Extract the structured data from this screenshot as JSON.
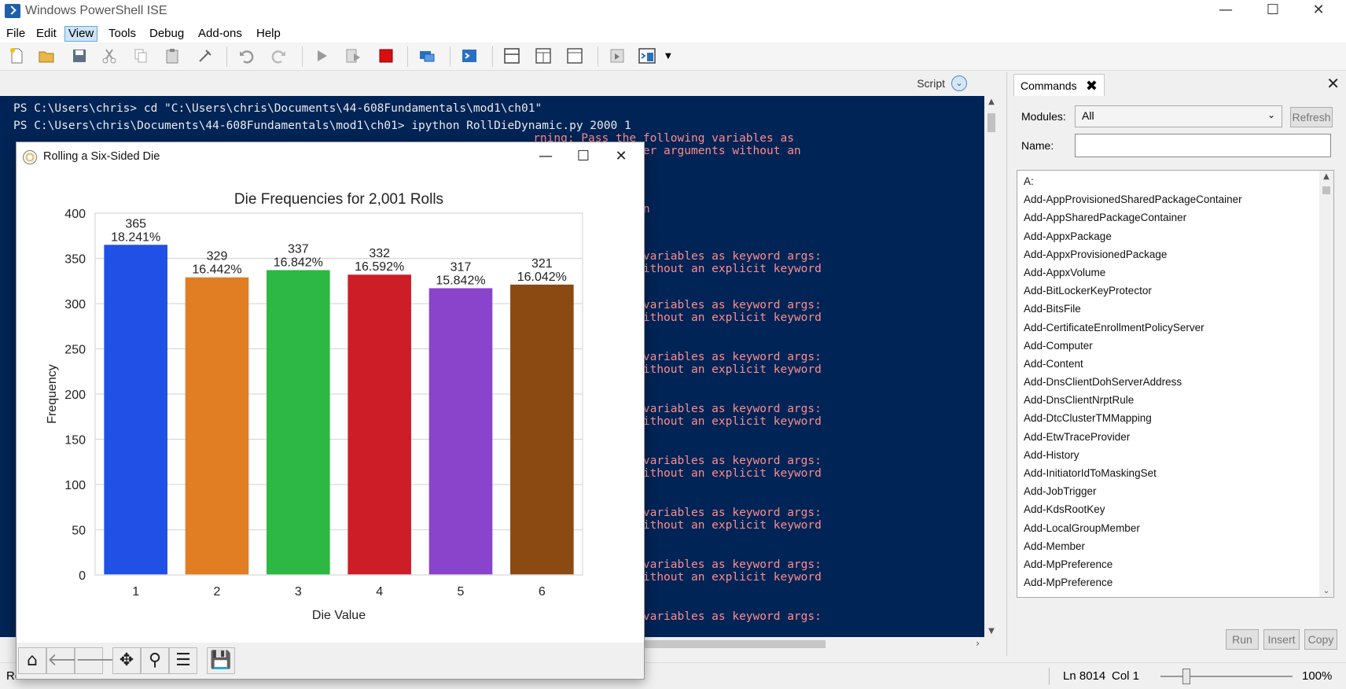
{
  "app": {
    "title": "Windows PowerShell ISE",
    "menu": [
      "File",
      "Edit",
      "View",
      "Tools",
      "Debug",
      "Add-ons",
      "Help"
    ],
    "active_menu": "View"
  },
  "script_bar": {
    "label": "Script"
  },
  "console": {
    "lines": [
      {
        "text": "PS C:\\Users\\chris> cd \"C:\\Users\\chris\\Documents\\44-608Fundamentals\\mod1\\ch01\"",
        "kind": "white"
      },
      {
        "text": "PS C:\\Users\\chris\\Documents\\44-608Fundamentals\\mod1\\ch01> ipython RollDieDynamic.py 2000 1",
        "kind": "white"
      },
      {
        "text": "rning: Pass the following variables as",
        "kind": "err",
        "col": 76
      },
      {
        "text": " and passing other arguments without an",
        "kind": "err",
        "col": 76
      },
      {
        "text": ", RemoteException",
        "kind": "err",
        "col": 76
      },
      {
        "text": "s the following variables as keyword args:",
        "kind": "err",
        "col": 76
      },
      {
        "text": "ther arguments without an explicit keyword",
        "kind": "err",
        "col": 76
      },
      {
        "text": "s the following variables as keyword args:",
        "kind": "err",
        "col": 76
      },
      {
        "text": "ther arguments without an explicit keyword",
        "kind": "err",
        "col": 76
      },
      {
        "text": "s the following variables as keyword args:",
        "kind": "err",
        "col": 76
      },
      {
        "text": "ther arguments without an explicit keyword",
        "kind": "err",
        "col": 76
      },
      {
        "text": "s the following variables as keyword args:",
        "kind": "err",
        "col": 76
      },
      {
        "text": "ther arguments without an explicit keyword",
        "kind": "err",
        "col": 76
      },
      {
        "text": "s the following variables as keyword args:",
        "kind": "err",
        "col": 76
      },
      {
        "text": "ther arguments without an explicit keyword",
        "kind": "err",
        "col": 76
      },
      {
        "text": "s the following variables as keyword args:",
        "kind": "err",
        "col": 76
      },
      {
        "text": "ther arguments without an explicit keyword",
        "kind": "err",
        "col": 76
      },
      {
        "text": "s the following variables as keyword args:",
        "kind": "err",
        "col": 76
      },
      {
        "text": "ther arguments without an explicit keyword",
        "kind": "err",
        "col": 76
      },
      {
        "text": "s the following variables as keyword args:",
        "kind": "err",
        "col": 76
      }
    ]
  },
  "commands": {
    "tab_label": "Commands",
    "modules_label": "Modules:",
    "modules_value": "All",
    "refresh_label": "Refresh",
    "name_label": "Name:",
    "name_value": "",
    "items": [
      "A:",
      "Add-AppProvisionedSharedPackageContainer",
      "Add-AppSharedPackageContainer",
      "Add-AppxPackage",
      "Add-AppxProvisionedPackage",
      "Add-AppxVolume",
      "Add-BitLockerKeyProtector",
      "Add-BitsFile",
      "Add-CertificateEnrollmentPolicyServer",
      "Add-Computer",
      "Add-Content",
      "Add-DnsClientDohServerAddress",
      "Add-DnsClientNrptRule",
      "Add-DtcClusterTMMapping",
      "Add-EtwTraceProvider",
      "Add-History",
      "Add-InitiatorIdToMaskingSet",
      "Add-JobTrigger",
      "Add-KdsRootKey",
      "Add-LocalGroupMember",
      "Add-Member",
      "Add-MpPreference",
      "Add-MpPreference"
    ],
    "run_label": "Run",
    "insert_label": "Insert",
    "copy_label": "Copy"
  },
  "status": {
    "left_text": "Ro",
    "line": "Ln 8014",
    "col": "Col 1",
    "zoom": "100%"
  },
  "plot_window": {
    "title": "Rolling a Six-Sided Die"
  },
  "chart_data": {
    "type": "bar",
    "title": "Die Frequencies for 2,001 Rolls",
    "xlabel": "Die Value",
    "ylabel": "Frequency",
    "categories": [
      "1",
      "2",
      "3",
      "4",
      "5",
      "6"
    ],
    "values": [
      365,
      329,
      337,
      332,
      317,
      321
    ],
    "percent_labels": [
      "18.241%",
      "16.442%",
      "16.842%",
      "16.592%",
      "15.842%",
      "16.042%"
    ],
    "colors": [
      "#2150e6",
      "#e17d22",
      "#2db744",
      "#cd1e28",
      "#8a44cc",
      "#8b4a12"
    ],
    "ylim": [
      0,
      400
    ],
    "yticks": [
      0,
      50,
      100,
      150,
      200,
      250,
      300,
      350,
      400
    ],
    "grid": true
  }
}
